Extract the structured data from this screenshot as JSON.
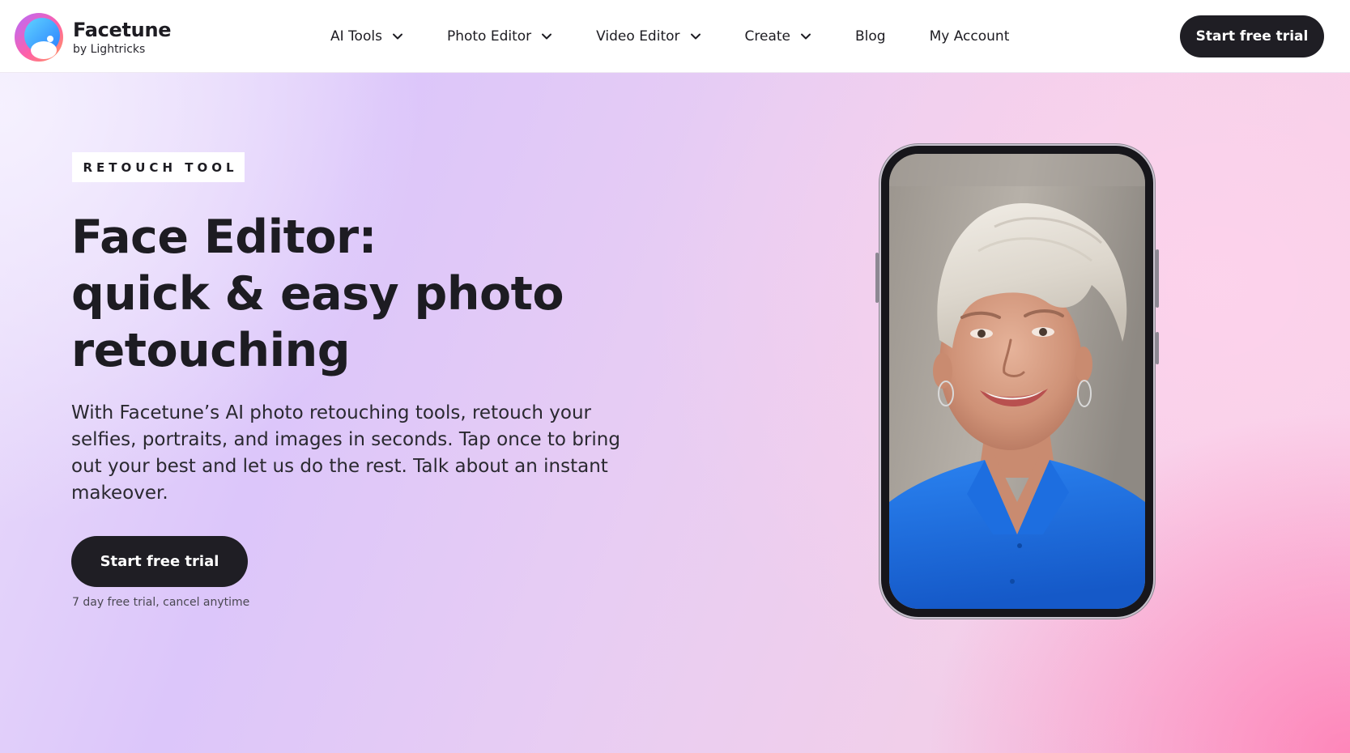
{
  "brand": {
    "name": "Facetune",
    "byline": "by Lightricks"
  },
  "nav": {
    "items": [
      {
        "label": "AI Tools",
        "has_dropdown": true
      },
      {
        "label": "Photo Editor",
        "has_dropdown": true
      },
      {
        "label": "Video Editor",
        "has_dropdown": true
      },
      {
        "label": "Create",
        "has_dropdown": true
      },
      {
        "label": "Blog",
        "has_dropdown": false
      },
      {
        "label": "My Account",
        "has_dropdown": false
      }
    ],
    "cta_label": "Start free trial"
  },
  "hero": {
    "badge": "RETOUCH TOOL",
    "title_lines": [
      "Face Editor:",
      "quick & easy photo",
      "retouching"
    ],
    "description": "With Facetune’s AI photo retouching tools, retouch your selfies, portraits, and images in seconds. Tap once to bring out your best and let us do the rest. Talk about an instant makeover.",
    "cta_label": "Start free trial",
    "note": "7 day free trial, cancel anytime"
  },
  "colors": {
    "button_dark": "#1f1e24",
    "text_dark": "#1d1c22",
    "shirt_blue": "#1f6fe0"
  },
  "icons": {
    "logo": "facetune-logo-icon",
    "dropdown": "chevron-down-icon"
  }
}
